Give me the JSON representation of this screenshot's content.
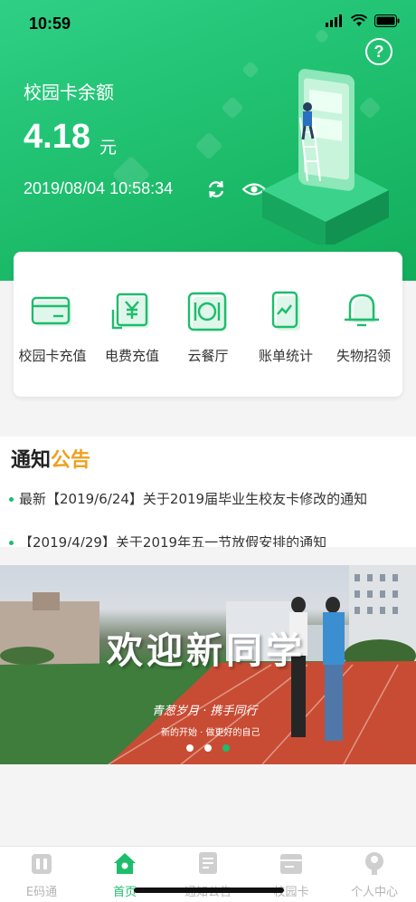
{
  "status_bar": {
    "time": "10:59"
  },
  "header": {
    "help_symbol": "?",
    "balance_label": "校园卡余额",
    "balance_amount": "4.18",
    "balance_unit": "元",
    "timestamp": "2019/08/04 10:58:34",
    "icons": [
      "refresh-icon",
      "eye-icon",
      "help-icon"
    ]
  },
  "services": [
    {
      "label": "校园卡充值",
      "icon": "card-icon"
    },
    {
      "label": "电费充值",
      "icon": "yuan-icon"
    },
    {
      "label": "云餐厅",
      "icon": "dining-icon"
    },
    {
      "label": "账单统计",
      "icon": "chart-icon"
    },
    {
      "label": "失物招领",
      "icon": "bell-icon"
    }
  ],
  "notice": {
    "title_a": "通知",
    "title_b": "公告",
    "items": [
      "最新【2019/6/24】关于2019届毕业生校友卡修改的通知",
      "【2019/4/29】关于2019年五一节放假安排的通知"
    ]
  },
  "banner": {
    "title": "欢迎新同学",
    "subtitle": "青葱岁月 · 携手同行",
    "subtitle2": "新的开始 · 做更好的自己",
    "active_slide": 2,
    "slide_count": 3
  },
  "tabbar": {
    "tabs": [
      {
        "label": "E码通",
        "icon": "code-icon"
      },
      {
        "label": "首页",
        "icon": "home-icon"
      },
      {
        "label": "通知公告",
        "icon": "notice-icon"
      },
      {
        "label": "校园卡",
        "icon": "campus-card-icon"
      },
      {
        "label": "个人中心",
        "icon": "person-icon"
      }
    ],
    "active_index": 1
  },
  "colors": {
    "primary": "#1dbd6c",
    "accent": "#f0a020",
    "inactive": "#b5b5b5"
  }
}
